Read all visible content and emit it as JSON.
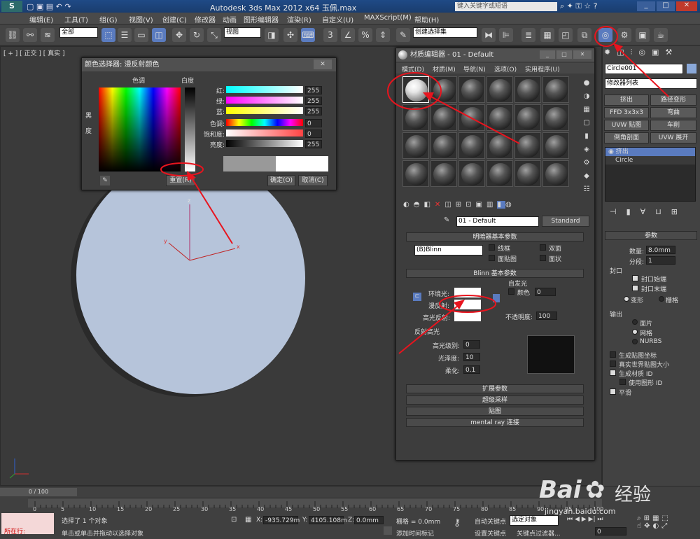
{
  "app": {
    "title": "Autodesk 3ds Max  2012 x64    玉佩.max",
    "search_placeholder": "键入关键字或短语"
  },
  "menu": [
    "编辑(E)",
    "工具(T)",
    "组(G)",
    "视图(V)",
    "创建(C)",
    "修改器",
    "动画",
    "图形编辑器",
    "渲染(R)",
    "自定义(U)",
    "MAXScript(M)",
    "帮助(H)"
  ],
  "toolbar": {
    "filter": "全部",
    "view": "视图",
    "selection_set": "创建选择集"
  },
  "viewport": {
    "label": "[ + ] [ 正交 ] [ 真实 ]"
  },
  "color_selector": {
    "title": "颜色选择器: 漫反射颜色",
    "hue_label": "色调",
    "white_label": "白度",
    "black_label": "黑",
    "degree_label": "度",
    "sliders": [
      {
        "label": "红:",
        "value": "255"
      },
      {
        "label": "绿:",
        "value": "255"
      },
      {
        "label": "蓝:",
        "value": "255"
      },
      {
        "label": "色调:",
        "value": "0"
      },
      {
        "label": "饱和度:",
        "value": "0"
      },
      {
        "label": "亮度:",
        "value": "255"
      }
    ],
    "reset": "重置(R)",
    "ok": "确定(O)",
    "cancel": "取消(C)"
  },
  "material_editor": {
    "title": "材质编辑器 - 01 - Default",
    "menu": [
      "模式(D)",
      "材质(M)",
      "导航(N)",
      "选项(O)",
      "实用程序(U)"
    ],
    "material_name": "01 - Default",
    "material_type": "Standard",
    "shader_rollout": "明暗器基本参数",
    "shader": "(B)Blinn",
    "shader_opts": [
      "线框",
      "双面",
      "面贴图",
      "面状"
    ],
    "blinn_rollout": "Blinn 基本参数",
    "self_illum": "自发光",
    "self_color": "颜色",
    "self_value": "0",
    "ambient": "环境光:",
    "diffuse": "漫反射:",
    "specular": "高光反射:",
    "opacity_label": "不透明度:",
    "opacity": "100",
    "highlights": "反射高光",
    "spec_level": "高光级别:",
    "spec_level_val": "0",
    "gloss": "光泽度:",
    "gloss_val": "10",
    "soften": "柔化:",
    "soften_val": "0.1",
    "rollouts": [
      "扩展参数",
      "超级采样",
      "贴图",
      "mental ray 连接"
    ]
  },
  "cmd_panel": {
    "object_name": "Circle001",
    "modifier_list": "修改器列表",
    "mod_buttons": [
      "挤出",
      "路径变形",
      "FFD 3x3x3",
      "弯曲",
      "UVW 贴图",
      "车削",
      "倒角剖面",
      "UVW 展开"
    ],
    "stack": [
      "挤出",
      "Circle"
    ],
    "params_title": "参数",
    "amount_label": "数量:",
    "amount": "8.0mm",
    "segments_label": "分段:",
    "segments": "1",
    "capping": "封口",
    "cap_start": "封口始端",
    "cap_end": "封口末端",
    "morph": "变形",
    "grid": "栅格",
    "output": "输出",
    "patch": "面片",
    "mesh": "网格",
    "nurbs": "NURBS",
    "gen_coords": "生成贴图坐标",
    "real_world": "真实世界贴图大小",
    "gen_mat_ids": "生成材质 ID",
    "use_shape_ids": "使用图形 ID",
    "smooth": "平滑"
  },
  "status": {
    "frame": "0 / 100",
    "msg1": "选择了 1 个对象",
    "msg2": "单击或单击并拖动以选择对象",
    "x_label": "X:",
    "x": "-935.729m",
    "y_label": "Y:",
    "y": "4105.108m",
    "z_label": "Z:",
    "z": "0.0mm",
    "grid": "栅格 = 0.0mm",
    "add_tag": "添加时间标记",
    "auto_key": "自动关键点",
    "set_key": "设置关键点",
    "selected": "选定对象",
    "key_filter": "关键点过滤器...",
    "running": "所在行:",
    "frame_val": "0",
    "ticks": [
      "0",
      "5",
      "10",
      "15",
      "20",
      "25",
      "30",
      "35",
      "40",
      "45",
      "50",
      "55",
      "60",
      "65",
      "70",
      "75",
      "80",
      "85",
      "90",
      "95",
      "100"
    ]
  },
  "watermark": {
    "brand": "Bai",
    "brand2": "经验",
    "url": "jingyan.baidu.com"
  },
  "colors": {
    "accent": "#5a7bbf",
    "annotation": "#e8141e",
    "disc": "#b6c4da"
  }
}
